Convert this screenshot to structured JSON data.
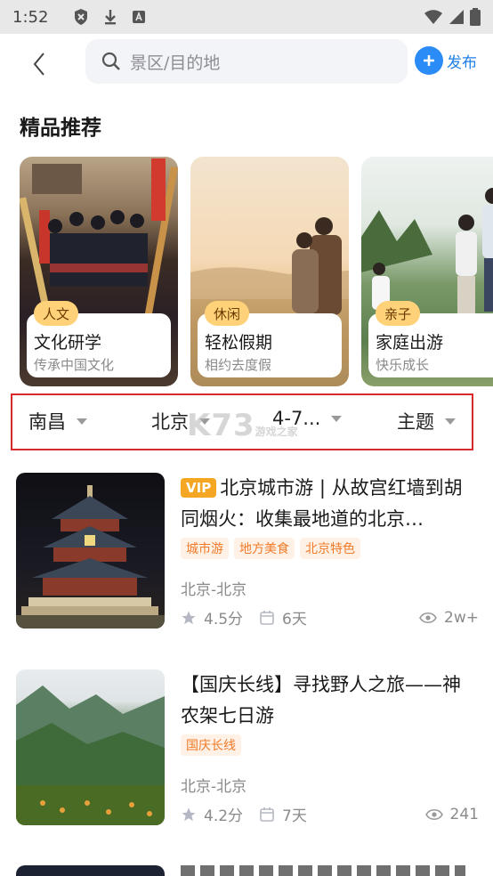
{
  "status_bar": {
    "time": "1:52"
  },
  "header": {
    "search_placeholder": "景区/目的地",
    "publish_label": "发布"
  },
  "section_title": "精品推荐",
  "featured": [
    {
      "tag": "人文",
      "title": "文化研学",
      "subtitle": "传承中国文化"
    },
    {
      "tag": "休闲",
      "title": "轻松假期",
      "subtitle": "相约去度假"
    },
    {
      "tag": "亲子",
      "title": "家庭出游",
      "subtitle": "快乐成长"
    }
  ],
  "filters": [
    {
      "label": "南昌"
    },
    {
      "label": "北京"
    },
    {
      "label": "4-7..."
    },
    {
      "label": "主题"
    }
  ],
  "watermark": {
    "text": "K73",
    "sub": "游戏之家"
  },
  "trips": [
    {
      "vip": "VIP",
      "title": "北京城市游 | 从故宫红墙到胡同烟火：收集最地道的北京…",
      "tags": [
        "城市游",
        "地方美食",
        "北京特色"
      ],
      "route": "北京-北京",
      "rating": "4.5分",
      "days": "6天",
      "views": "2w+"
    },
    {
      "vip": "",
      "title": "【国庆长线】寻找野人之旅——神农架七日游",
      "tags": [
        "国庆长线"
      ],
      "route": "北京-北京",
      "rating": "4.2分",
      "days": "7天",
      "views": "241"
    }
  ],
  "colors": {
    "accent_blue": "#2b8cf8",
    "vip_orange": "#f5a623",
    "chip_orange": "#f07a28",
    "filter_highlight": "#d72b2b",
    "tag_yellow": "#ffd27a"
  }
}
